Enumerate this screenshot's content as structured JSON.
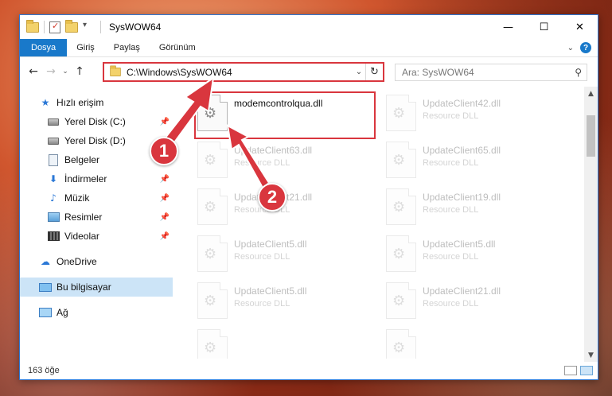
{
  "window": {
    "title": "SysWOW64",
    "minimize": "—",
    "maximize": "☐",
    "close": "✕"
  },
  "ribbon": {
    "tabs": [
      "Dosya",
      "Giriş",
      "Paylaş",
      "Görünüm"
    ],
    "expand": "⌄",
    "help": "?"
  },
  "address": {
    "back": "←",
    "forward": "→",
    "recent": "⌄",
    "up": "↑",
    "path": "C:\\Windows\\SysWOW64",
    "dropdown": "⌄",
    "refresh": "↻"
  },
  "search": {
    "placeholder": "Ara: SysWOW64",
    "icon": "⚲"
  },
  "nav": {
    "items": [
      {
        "label": "Hızlı erişim",
        "icon": "star-icon"
      },
      {
        "label": "Yerel Disk (C:)",
        "icon": "drive-icon",
        "pinned": true
      },
      {
        "label": "Yerel Disk (D:)",
        "icon": "drive-icon",
        "pinned": true
      },
      {
        "label": "Belgeler",
        "icon": "documents-icon",
        "pinned": false
      },
      {
        "label": "İndirmeler",
        "icon": "download-icon",
        "pinned": true
      },
      {
        "label": "Müzik",
        "icon": "music-icon",
        "pinned": true
      },
      {
        "label": "Resimler",
        "icon": "pictures-icon",
        "pinned": true
      },
      {
        "label": "Videolar",
        "icon": "videos-icon",
        "pinned": true
      },
      {
        "label": "OneDrive",
        "icon": "cloud-icon"
      },
      {
        "label": "Bu bilgisayar",
        "icon": "computer-icon",
        "selected": true
      },
      {
        "label": "Ağ",
        "icon": "network-icon"
      }
    ]
  },
  "files": [
    {
      "name": "modemcontrolqua.dll",
      "type": ""
    },
    {
      "name": "UpdateClient42.dll",
      "type": "Resource DLL"
    },
    {
      "name": "UpdateClient63.dll",
      "type": "Resource DLL"
    },
    {
      "name": "UpdateClient65.dll",
      "type": "Resource DLL"
    },
    {
      "name": "UpdateClient21.dll",
      "type": "Resource DLL"
    },
    {
      "name": "UpdateClient19.dll",
      "type": "Resource DLL"
    },
    {
      "name": "UpdateClient5.dll",
      "type": "Resource DLL"
    },
    {
      "name": "UpdateClient5.dll",
      "type": "Resource DLL"
    },
    {
      "name": "UpdateClient5.dll",
      "type": "Resource DLL"
    },
    {
      "name": "UpdateClient21.dll",
      "type": "Resource DLL"
    }
  ],
  "status": {
    "count": "163 öğe"
  },
  "annotations": {
    "step1": "1",
    "step2": "2",
    "color": "#d9363e"
  }
}
